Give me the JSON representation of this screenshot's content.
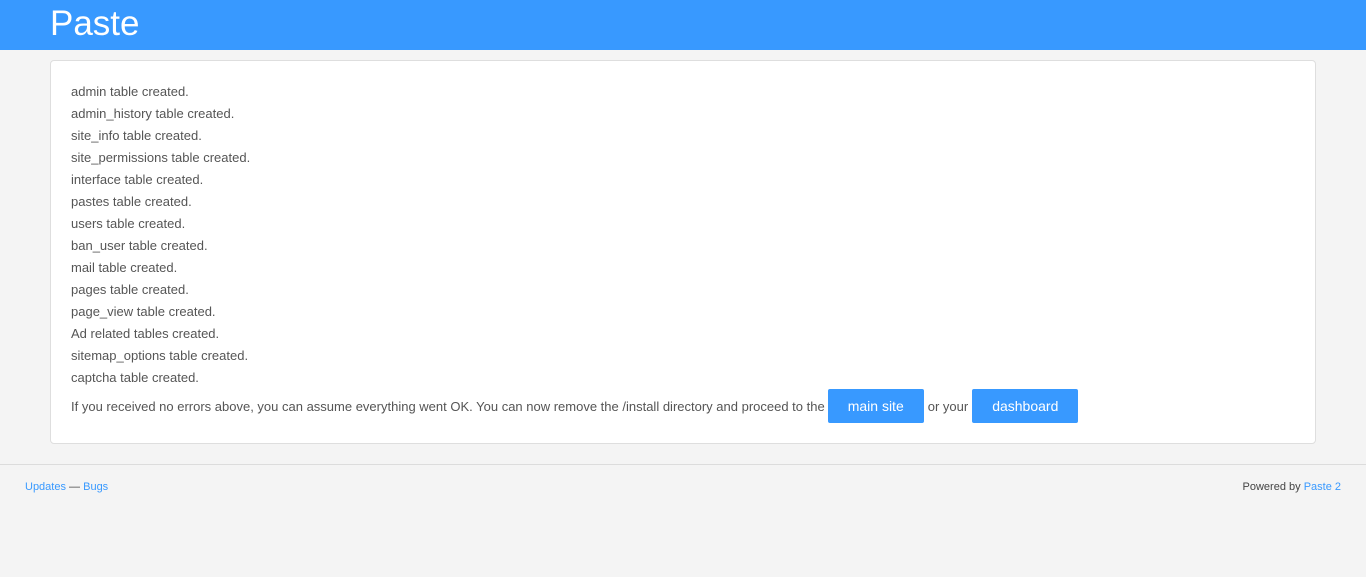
{
  "header": {
    "brand": "Paste"
  },
  "install_log": {
    "lines": [
      "admin table created.",
      "admin_history table created.",
      "site_info table created.",
      "site_permissions table created.",
      "interface table created.",
      "pastes table created.",
      "users table created.",
      "ban_user table created.",
      "mail table created.",
      "pages table created.",
      "page_view table created.",
      "Ad related tables created.",
      "sitemap_options table created.",
      "captcha table created."
    ],
    "finish_text": "If you received no errors above, you can assume everything went OK. You can now remove the /install directory and proceed to the",
    "main_site_label": "main site",
    "between_text": "or your",
    "dashboard_label": "dashboard"
  },
  "footer": {
    "updates_label": "Updates",
    "separator": "—",
    "bugs_label": "Bugs",
    "powered_by": "Powered by",
    "powered_link": "Paste 2"
  },
  "colors": {
    "accent": "#3899ff",
    "page_background": "#f4f4f4",
    "panel_background": "#ffffff",
    "text": "#555555"
  }
}
